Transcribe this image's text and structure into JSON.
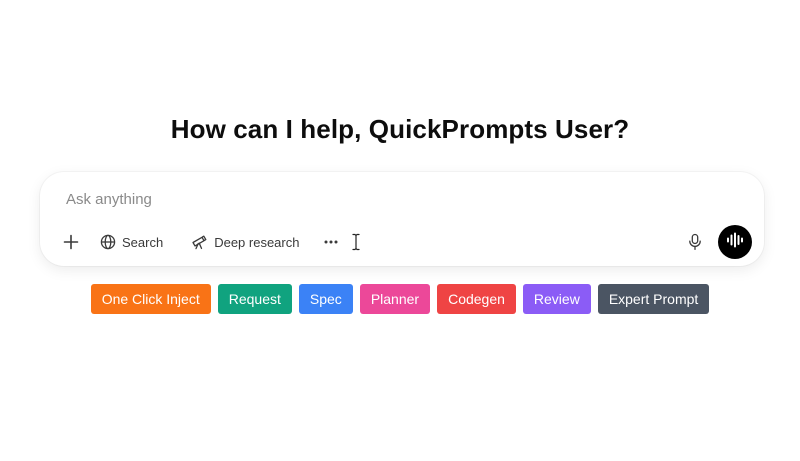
{
  "greeting": "How can I help, QuickPrompts User?",
  "composer": {
    "placeholder": "Ask anything",
    "tools": {
      "add_icon": "plus-icon",
      "search_label": "Search",
      "search_icon": "globe-icon",
      "deep_research_label": "Deep research",
      "deep_research_icon": "telescope-icon",
      "more_icon": "more-horizontal-icon",
      "mic_icon": "microphone-icon",
      "voice_icon": "voice-waveform-icon"
    }
  },
  "quick_prompts": [
    {
      "label": "One Click Inject",
      "color": "#f97316"
    },
    {
      "label": "Request",
      "color": "#10a37f"
    },
    {
      "label": "Spec",
      "color": "#3b82f6"
    },
    {
      "label": "Planner",
      "color": "#ec4899"
    },
    {
      "label": "Codegen",
      "color": "#ef4444"
    },
    {
      "label": "Review",
      "color": "#8b5cf6"
    },
    {
      "label": "Expert Prompt",
      "color": "#4b5563"
    }
  ]
}
